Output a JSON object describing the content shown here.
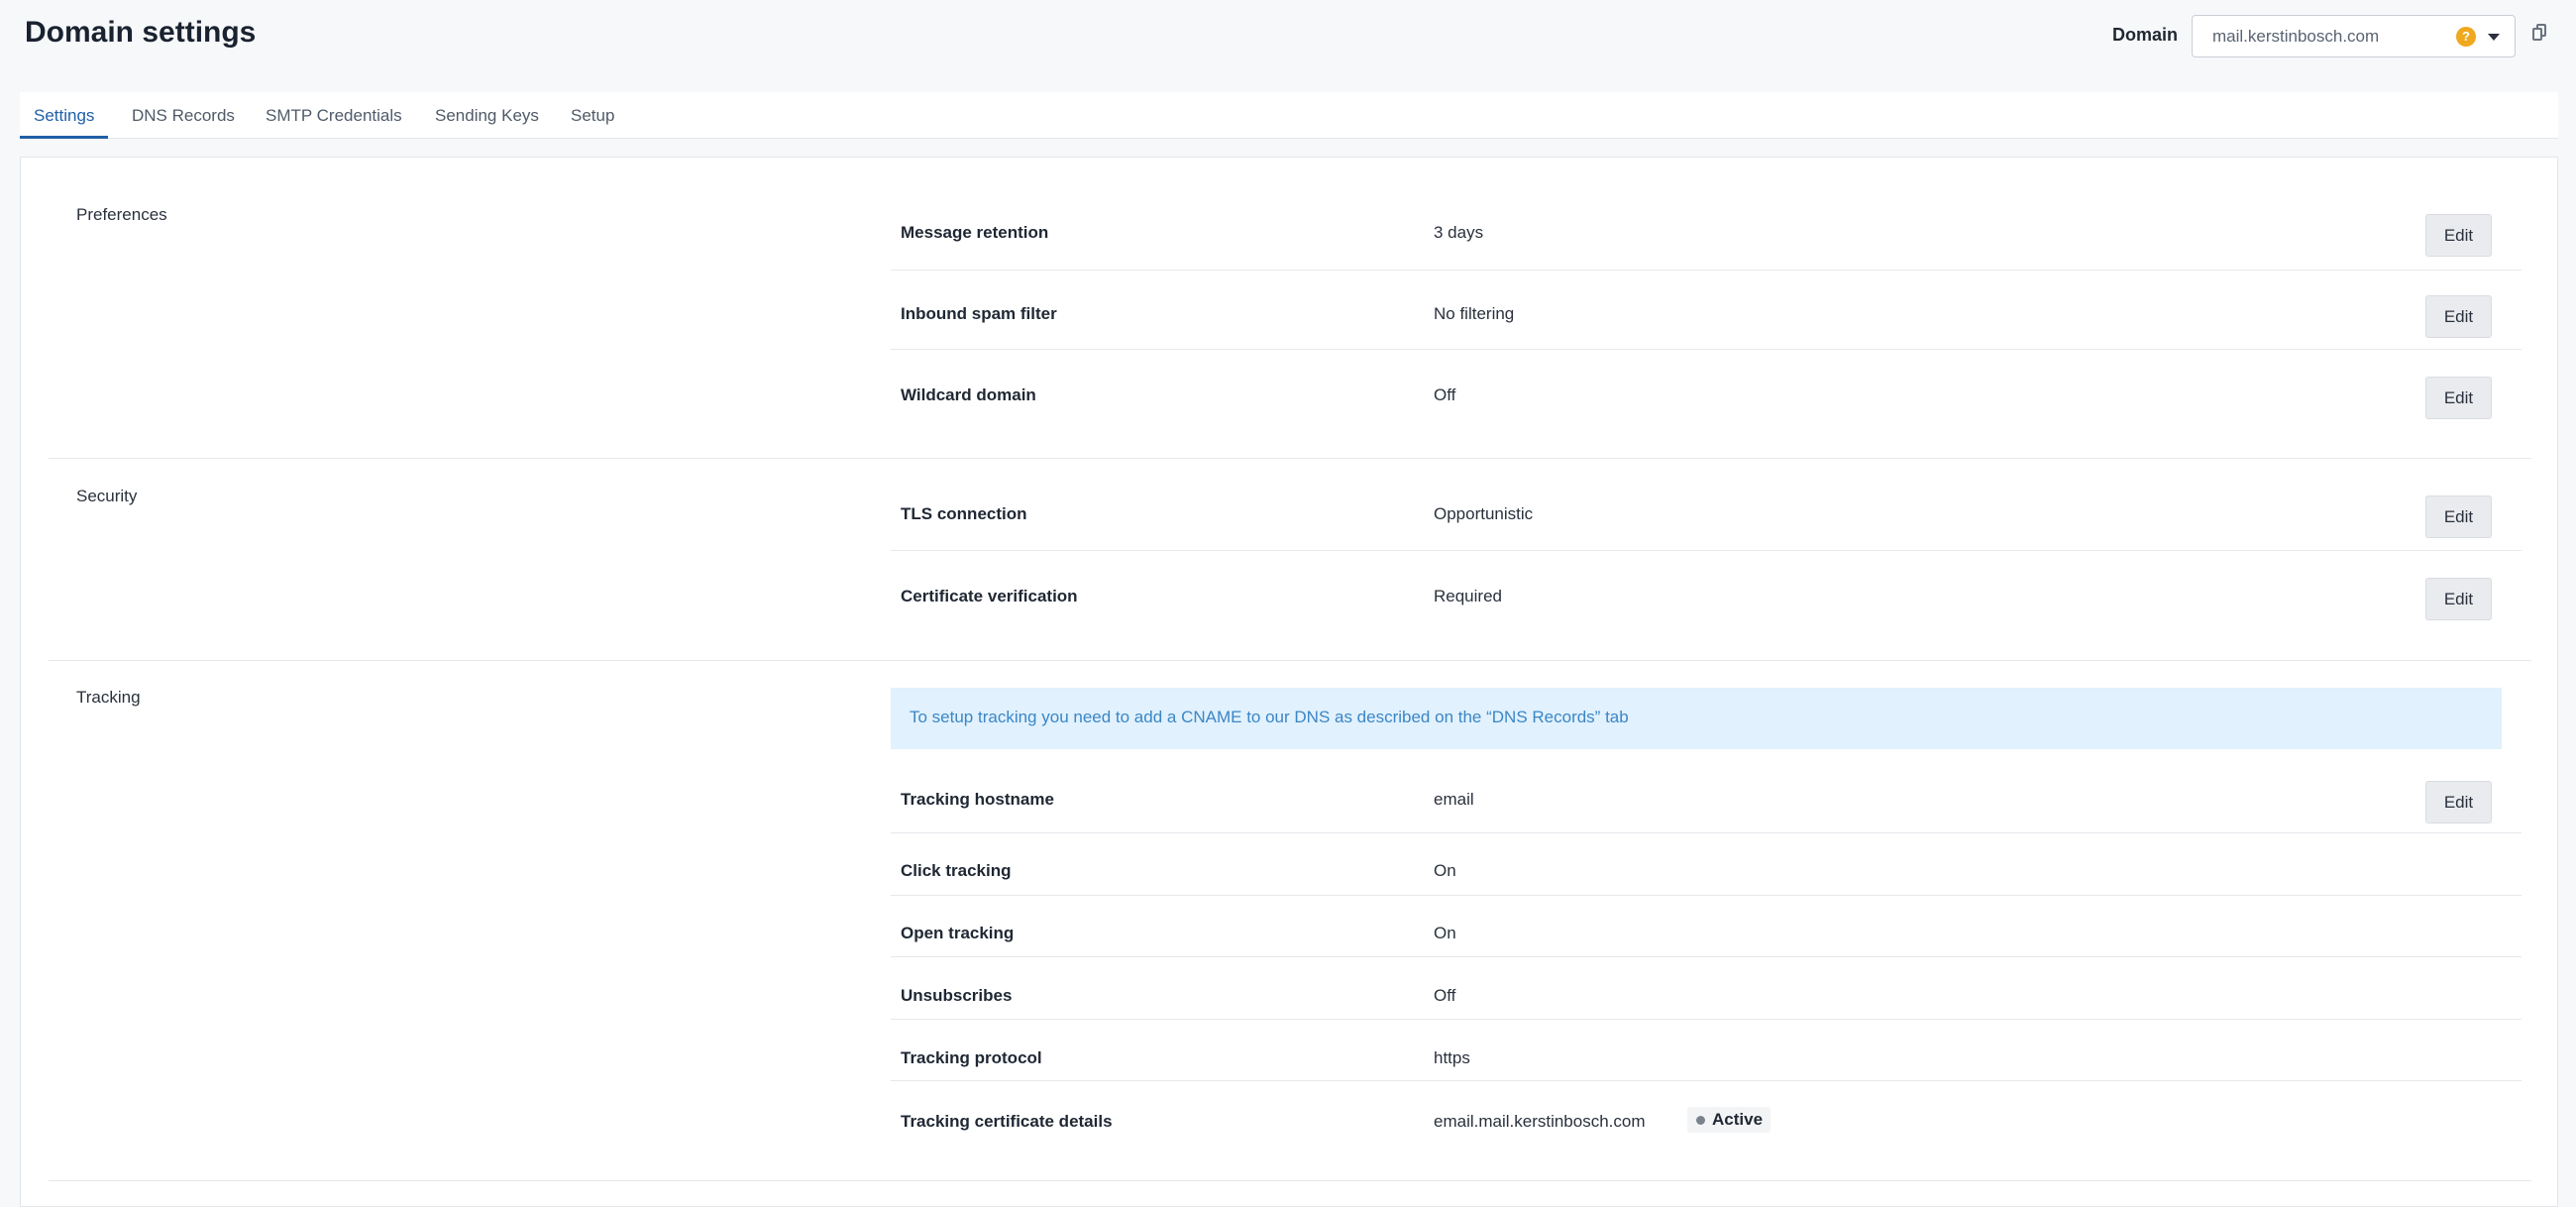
{
  "header": {
    "title": "Domain settings",
    "domain_label": "Domain",
    "domain_value": "mail.kerstinbosch.com",
    "warning_glyph": "?"
  },
  "tabs": [
    {
      "label": "Settings",
      "active": true
    },
    {
      "label": "DNS Records",
      "active": false
    },
    {
      "label": "SMTP Credentials",
      "active": false
    },
    {
      "label": "Sending Keys",
      "active": false
    },
    {
      "label": "Setup",
      "active": false
    }
  ],
  "edit_label": "Edit",
  "sections": {
    "preferences": {
      "title": "Preferences",
      "rows": [
        {
          "label": "Message retention",
          "value": "3 days"
        },
        {
          "label": "Inbound spam filter",
          "value": "No filtering"
        },
        {
          "label": "Wildcard domain",
          "value": "Off"
        }
      ]
    },
    "security": {
      "title": "Security",
      "rows": [
        {
          "label": "TLS connection",
          "value": "Opportunistic"
        },
        {
          "label": "Certificate verification",
          "value": "Required"
        }
      ]
    },
    "tracking": {
      "title": "Tracking",
      "info": "To setup tracking you need to add a CNAME to our DNS as described on the “DNS Records” tab",
      "rows": [
        {
          "label": "Tracking hostname",
          "value": "email"
        },
        {
          "label": "Click tracking",
          "value": "On"
        },
        {
          "label": "Open tracking",
          "value": "On"
        },
        {
          "label": "Unsubscribes",
          "value": "Off"
        },
        {
          "label": "Tracking protocol",
          "value": "https"
        },
        {
          "label": "Tracking certificate details",
          "value": "email.mail.kerstinbosch.com",
          "status": "Active"
        }
      ]
    }
  }
}
